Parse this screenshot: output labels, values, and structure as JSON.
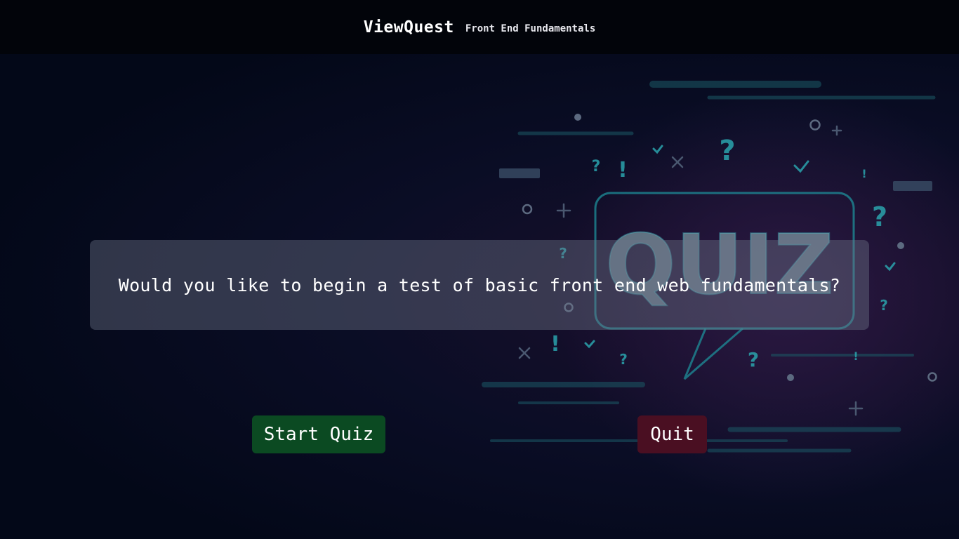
{
  "header": {
    "brand": "ViewQuest",
    "subtitle": "Front End Fundamentals"
  },
  "main": {
    "question": "Would you like to begin a test of basic front end web fundamentals?",
    "start_label": "Start Quiz",
    "quit_label": "Quit"
  },
  "background": {
    "art_text": "QUIZ"
  },
  "colors": {
    "start_button": "#0b4a22",
    "quit_button": "#4a0f22",
    "accent": "#1fa0a8"
  }
}
